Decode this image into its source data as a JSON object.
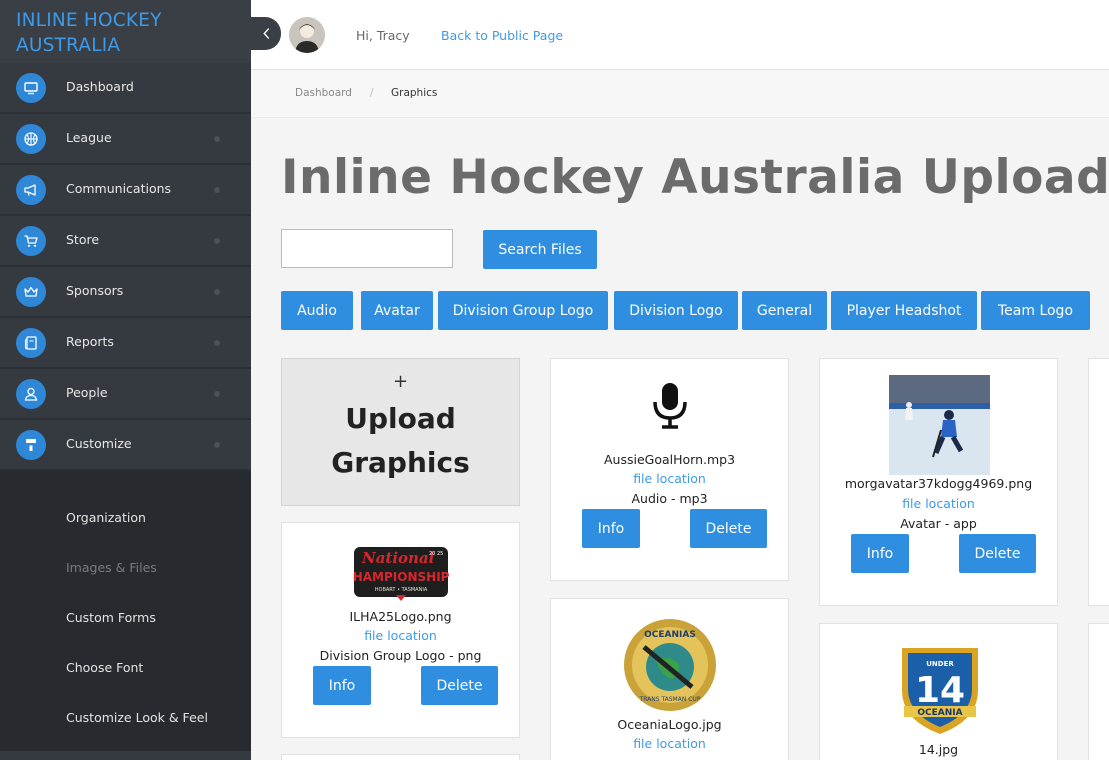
{
  "brand": {
    "line1": "INLINE HOCKEY",
    "line2": "AUSTRALIA"
  },
  "nav": [
    {
      "label": "Dashboard",
      "icon": "monitor-icon"
    },
    {
      "label": "League",
      "icon": "basketball-icon"
    },
    {
      "label": "Communications",
      "icon": "megaphone-icon"
    },
    {
      "label": "Store",
      "icon": "cart-icon"
    },
    {
      "label": "Sponsors",
      "icon": "crown-icon"
    },
    {
      "label": "Reports",
      "icon": "document-icon"
    },
    {
      "label": "People",
      "icon": "user-icon"
    },
    {
      "label": "Customize",
      "icon": "paint-roller-icon"
    }
  ],
  "submenu": [
    "Organization",
    "Images & Files",
    "Custom Forms",
    "Choose Font",
    "Customize Look & Feel"
  ],
  "header": {
    "greeting": "Hi, Tracy",
    "back_link": "Back to Public Page"
  },
  "breadcrumb": {
    "home": "Dashboard",
    "sep": "/",
    "current": "Graphics"
  },
  "page_title": "Inline Hockey Australia Uploaded",
  "search": {
    "value": "",
    "button": "Search Files"
  },
  "categories": [
    "Audio",
    "Avatar",
    "Division Group Logo",
    "Division Logo",
    "General",
    "Player Headshot",
    "Team Logo"
  ],
  "upload": {
    "plus": "+",
    "line1": "Upload",
    "line2": "Graphics"
  },
  "files": [
    {
      "name": "ILHA25Logo.png",
      "location": "file location",
      "type": "Division Group Logo - png",
      "info": "Info",
      "delete": "Delete"
    },
    {
      "name": "AussieGoalHorn.mp3",
      "location": "file location",
      "type": "Audio - mp3",
      "info": "Info",
      "delete": "Delete"
    },
    {
      "name": "morgavatar37kdogg4969.png",
      "location": "file location",
      "type": "Avatar - app",
      "info": "Info",
      "delete": "Delete"
    },
    {
      "name": "OceaniaLogo.jpg",
      "location": "file location"
    },
    {
      "name": "14.jpg"
    }
  ],
  "thumb_text": {
    "national": "National",
    "championships": "CHAMPIONSHIPS",
    "hobart": "HOBART • TASMANIA",
    "year_left": "20",
    "year_right": "25",
    "oceanias": "OCEANIAS",
    "trans_tasman": "TRANS TASMAN CUP",
    "under": "UNDER",
    "fourteen": "14",
    "oceania": "OCEANIA"
  },
  "colors": {
    "accent": "#2f8ee0",
    "sidebar": "#2b3036",
    "brand": "#3d9ae8"
  }
}
